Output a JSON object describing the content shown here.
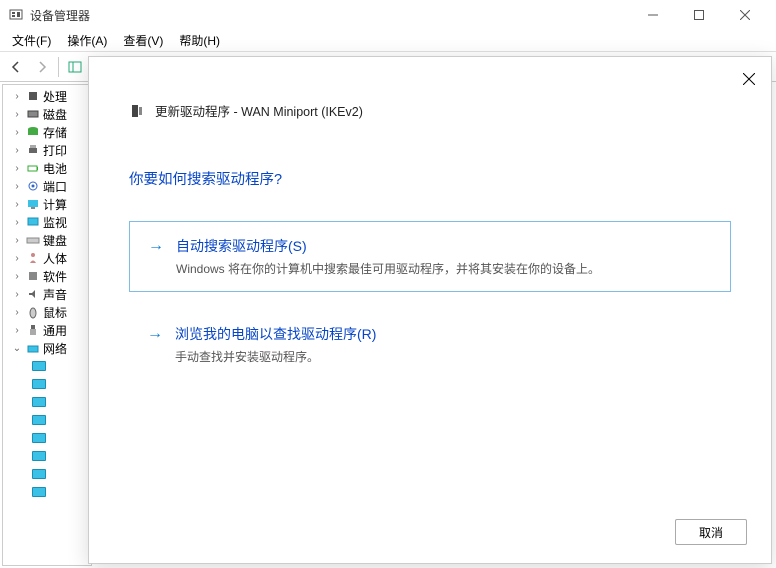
{
  "window": {
    "title": "设备管理器"
  },
  "menu": {
    "file": "文件(F)",
    "action": "操作(A)",
    "view": "查看(V)",
    "help": "帮助(H)"
  },
  "tree": {
    "items": [
      {
        "label": "处理",
        "icon": "cpu"
      },
      {
        "label": "磁盘",
        "icon": "disk"
      },
      {
        "label": "存储",
        "icon": "storage"
      },
      {
        "label": "打印",
        "icon": "printer"
      },
      {
        "label": "电池",
        "icon": "battery"
      },
      {
        "label": "端口",
        "icon": "port"
      },
      {
        "label": "计算",
        "icon": "computer"
      },
      {
        "label": "监视",
        "icon": "monitor"
      },
      {
        "label": "键盘",
        "icon": "keyboard"
      },
      {
        "label": "人体",
        "icon": "hid"
      },
      {
        "label": "软件",
        "icon": "software"
      },
      {
        "label": "声音",
        "icon": "audio"
      },
      {
        "label": "鼠标",
        "icon": "mouse"
      },
      {
        "label": "通用",
        "icon": "usb"
      },
      {
        "label": "网络",
        "icon": "network",
        "expanded": true
      }
    ],
    "network_children_count": 8
  },
  "dialog": {
    "header": "更新驱动程序 - WAN Miniport (IKEv2)",
    "question": "你要如何搜索驱动程序?",
    "option_auto": {
      "title": "自动搜索驱动程序(S)",
      "desc": "Windows 将在你的计算机中搜索最佳可用驱动程序，并将其安装在你的设备上。"
    },
    "option_browse": {
      "title": "浏览我的电脑以查找驱动程序(R)",
      "desc": "手动查找并安装驱动程序。"
    },
    "cancel": "取消"
  }
}
